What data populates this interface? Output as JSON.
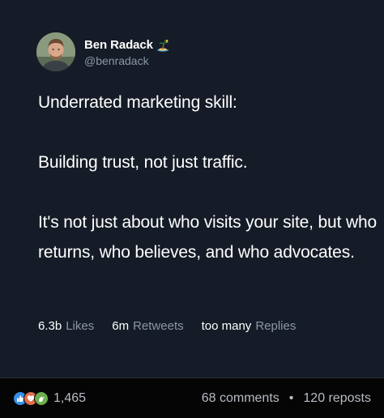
{
  "author": {
    "display_name": "Ben Radack",
    "handle": "@benradack",
    "name_emoji": "desert-island-emoji",
    "avatar": "profile-photo"
  },
  "tweet": {
    "paragraphs": [
      "Underrated marketing skill:",
      "Building trust, not just traffic.",
      "It's not just about who visits your site, but who returns, who believes, and who advocates."
    ]
  },
  "stats": {
    "likes_value": "6.3b",
    "likes_label": "Likes",
    "retweets_value": "6m",
    "retweets_label": "Retweets",
    "replies_value": "too many",
    "replies_label": "Replies"
  },
  "post_footer": {
    "reaction_icons": [
      "like-icon",
      "love-icon",
      "celebrate-icon"
    ],
    "reaction_count": "1,465",
    "comments": "68 comments",
    "separator": "•",
    "reposts": "120 reposts"
  },
  "colors": {
    "card_background": "#151c27",
    "text_primary": "#ffffff",
    "text_secondary": "#8b97a6",
    "footer_background": "#050505"
  }
}
